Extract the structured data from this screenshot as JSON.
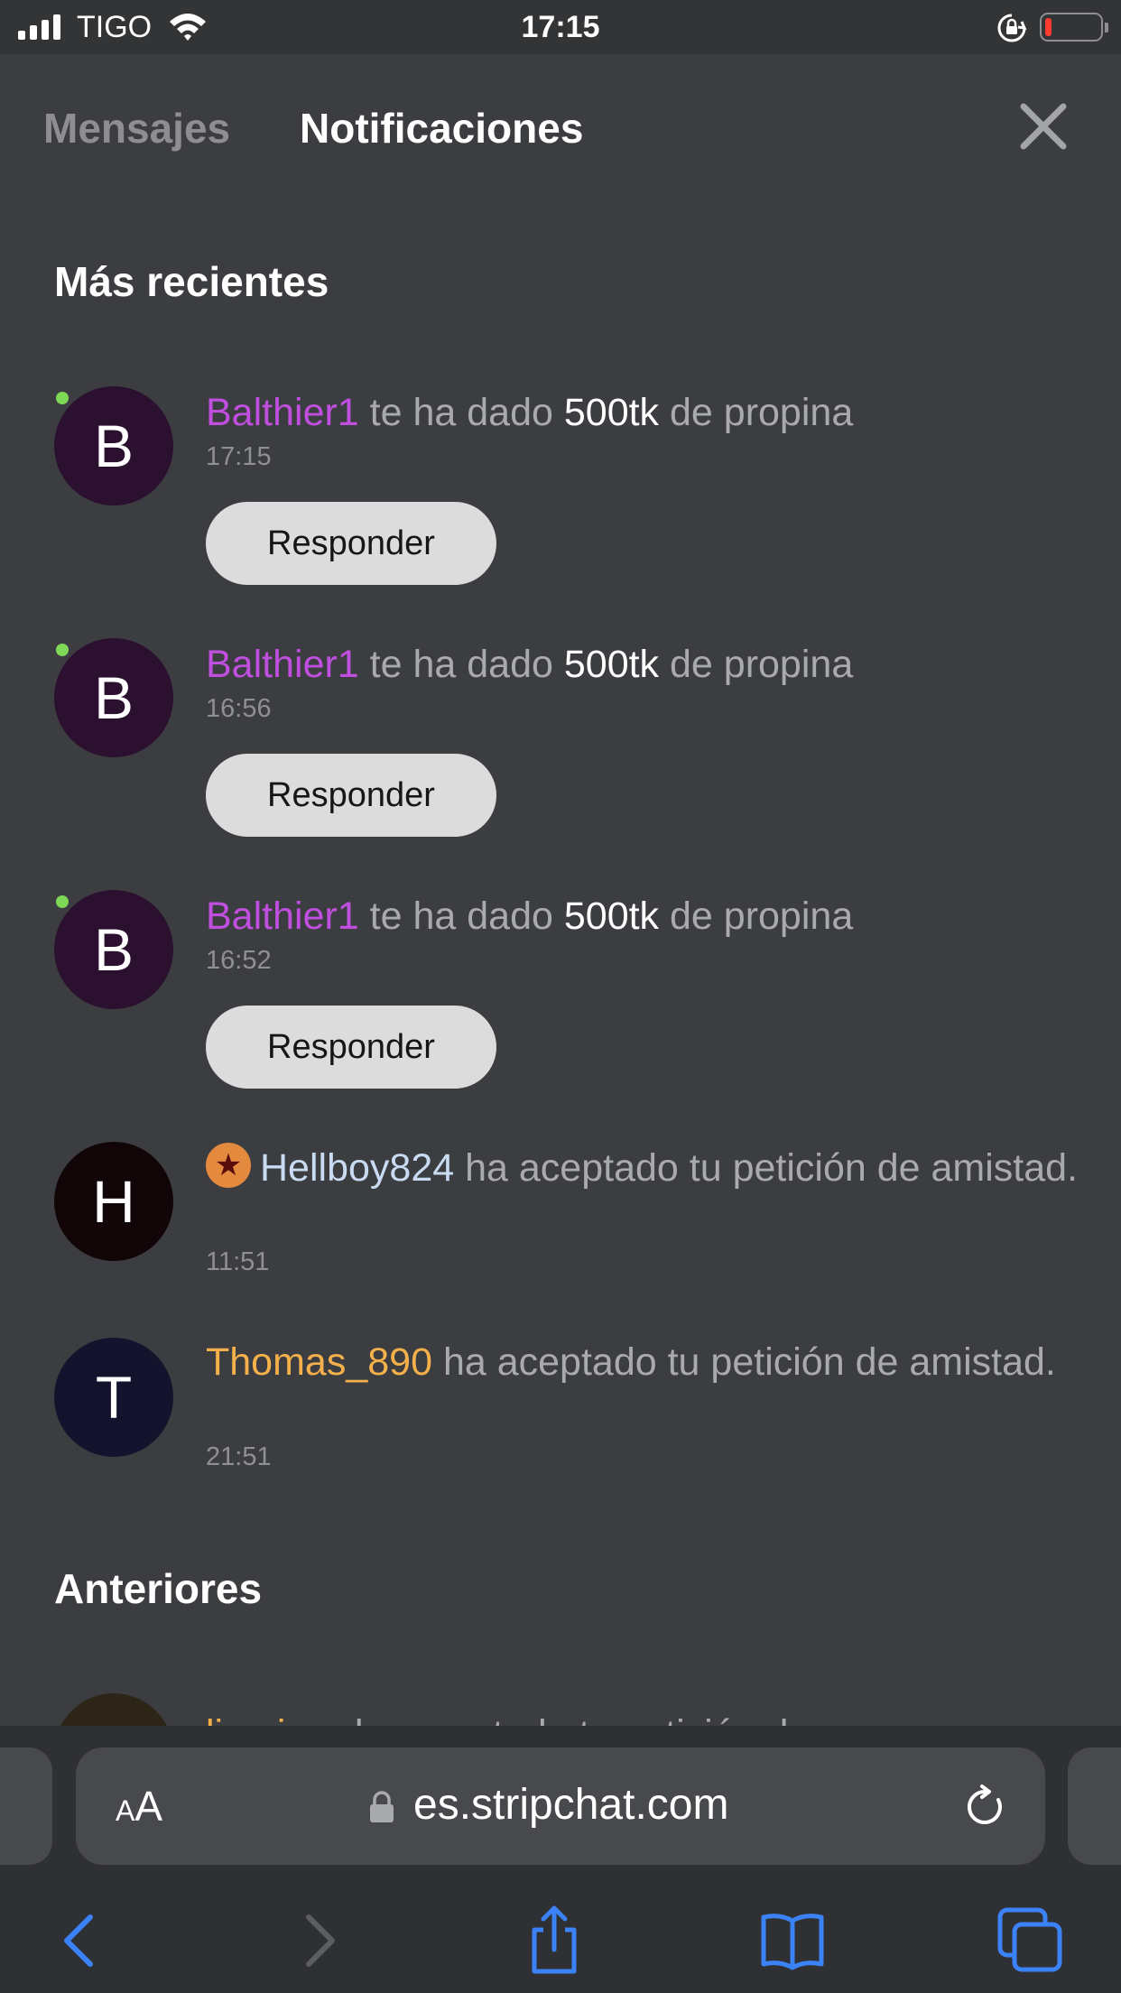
{
  "status_bar": {
    "carrier": "TIGO",
    "time": "17:15"
  },
  "tabs": {
    "messages": "Mensajes",
    "notifications": "Notificaciones"
  },
  "sections": {
    "recent": "Más recientes",
    "previous": "Anteriores"
  },
  "notifications": [
    {
      "avatar_letter": "B",
      "avatar_color": "#2b1030",
      "username": "Balthier1",
      "text_1": " te ha dado ",
      "amount": "500tk",
      "text_2": " de propina",
      "time": "17:15",
      "button": "Responder"
    },
    {
      "avatar_letter": "B",
      "avatar_color": "#2b1030",
      "username": "Balthier1",
      "text_1": " te ha dado ",
      "amount": "500tk",
      "text_2": " de propina",
      "time": "16:56",
      "button": "Responder"
    },
    {
      "avatar_letter": "B",
      "avatar_color": "#2b1030",
      "username": "Balthier1",
      "text_1": " te ha dado ",
      "amount": "500tk",
      "text_2": " de propina",
      "time": "16:52",
      "button": "Responder"
    },
    {
      "avatar_letter": "H",
      "avatar_color": "#120507",
      "badge_icon": "star-icon",
      "badge_color": "#e38a3f",
      "username": "Hellboy824",
      "text_1": " ha aceptado tu petición de amistad.",
      "time": "11:51"
    },
    {
      "avatar_letter": "T",
      "avatar_color": "#13132e",
      "username": "Thomas_890",
      "text_1": " ha aceptado tu petición de amistad.",
      "time": "21:51"
    }
  ],
  "previous_partial": {
    "username": "limaizzx",
    "text_1": " ha aceptado tu petición de"
  },
  "browser": {
    "aa_label_small": "A",
    "aa_label_large": "A",
    "url": "es.stripchat.com"
  },
  "icons": {
    "close": "close-icon",
    "lock": "lock-icon",
    "reload": "reload-icon",
    "back": "back-chevron-icon",
    "forward": "forward-chevron-icon",
    "share": "share-icon",
    "bookmarks": "bookmarks-icon",
    "tabs": "tabs-icon"
  },
  "colors": {
    "accent_blue": "#3b82f6",
    "online_dot": "#7ed957",
    "username_purple": "#c04fe0",
    "username_orange": "#f4b04a"
  }
}
